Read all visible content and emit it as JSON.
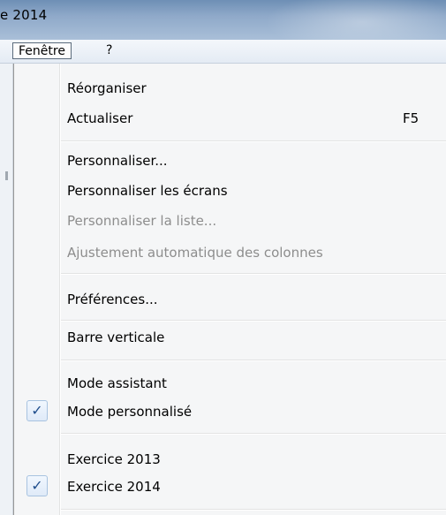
{
  "window": {
    "title": "e 2014"
  },
  "menubar": {
    "items": [
      {
        "label": "Fenêtre"
      },
      {
        "label": "?"
      }
    ]
  },
  "menu": {
    "items": [
      {
        "label": "Réorganiser",
        "shortcut": "",
        "enabled": true,
        "checked": false
      },
      {
        "label": "Actualiser",
        "shortcut": "F5",
        "enabled": true,
        "checked": false
      },
      {
        "label": "Personnaliser...",
        "shortcut": "",
        "enabled": true,
        "checked": false
      },
      {
        "label": "Personnaliser les écrans",
        "shortcut": "",
        "enabled": true,
        "checked": false
      },
      {
        "label": "Personnaliser la liste...",
        "shortcut": "",
        "enabled": false,
        "checked": false
      },
      {
        "label": "Ajustement automatique des colonnes",
        "shortcut": "",
        "enabled": false,
        "checked": false
      },
      {
        "label": "Préférences...",
        "shortcut": "",
        "enabled": true,
        "checked": false
      },
      {
        "label": "Barre verticale",
        "shortcut": "",
        "enabled": true,
        "checked": false
      },
      {
        "label": "Mode assistant",
        "shortcut": "",
        "enabled": true,
        "checked": false
      },
      {
        "label": "Mode personnalisé",
        "shortcut": "",
        "enabled": true,
        "checked": true
      },
      {
        "label": "Exercice 2013",
        "shortcut": "",
        "enabled": true,
        "checked": false
      },
      {
        "label": "Exercice 2014",
        "shortcut": "",
        "enabled": true,
        "checked": true
      }
    ]
  },
  "icons": {
    "checkmark": "checkmark-icon",
    "checkmark_glyph": "✓"
  },
  "colors": {
    "disabled_text": "#8d8d8d",
    "menu_background": "#f5f6f7",
    "check_accent": "#1f4e8c"
  }
}
